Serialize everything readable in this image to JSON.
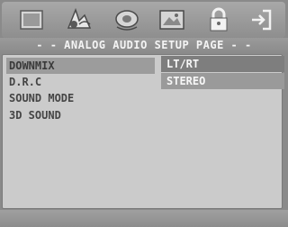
{
  "header": {
    "title": "- - ANALOG AUDIO SETUP PAGE - -",
    "icons": [
      "general-setup-icon",
      "audio-setup-icon",
      "video-setup-icon",
      "preference-setup-icon",
      "password-lock-icon",
      "exit-icon"
    ],
    "active_icon": "audio-setup-icon"
  },
  "menu": {
    "items": [
      {
        "label": "DOWNMIX",
        "selected": true
      },
      {
        "label": "D.R.C"
      },
      {
        "label": "SOUND MODE"
      },
      {
        "label": "3D SOUND"
      }
    ]
  },
  "submenu": {
    "options": [
      {
        "label": "LT/RT"
      },
      {
        "label": "STEREO",
        "selected": true
      }
    ]
  },
  "colors": {
    "frame": "#8a8a8a",
    "panel": "#cbcbcb",
    "highlight": "#9c9c9c",
    "option_bg": "#7e7e7e",
    "text_dark": "#454545",
    "text_light": "#f7f7f7"
  }
}
